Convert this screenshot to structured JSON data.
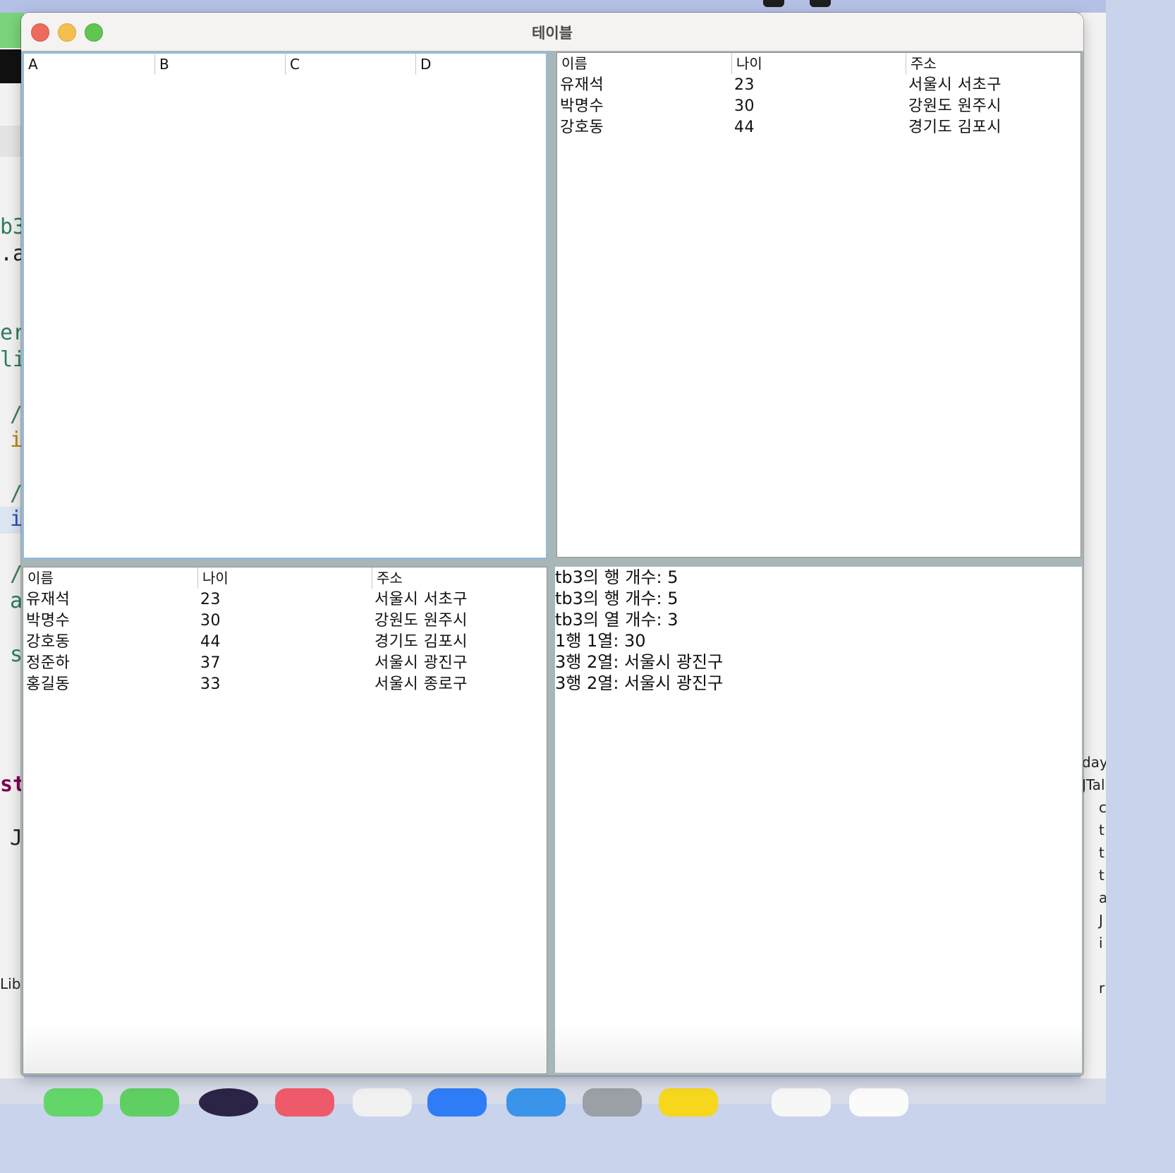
{
  "window": {
    "title": "테이블"
  },
  "table_empty": {
    "columns": [
      "A",
      "B",
      "C",
      "D"
    ]
  },
  "table_small": {
    "columns": [
      "이름",
      "나이",
      "주소"
    ],
    "rows": [
      [
        "유재석",
        "23",
        "서울시 서초구"
      ],
      [
        "박명수",
        "30",
        "강원도 원주시"
      ],
      [
        "강호동",
        "44",
        "경기도 김포시"
      ]
    ]
  },
  "table_full": {
    "columns": [
      "이름",
      "나이",
      "주소"
    ],
    "rows": [
      [
        "유재석",
        "23",
        "서울시 서초구"
      ],
      [
        "박명수",
        "30",
        "강원도 원주시"
      ],
      [
        "강호동",
        "44",
        "경기도 김포시"
      ],
      [
        "정준하",
        "37",
        "서울시 광진구"
      ],
      [
        "홍길동",
        "33",
        "서울시 종로구"
      ]
    ]
  },
  "output_log": [
    "tb3의 행 개수: 5",
    "tb3의 행 개수: 5",
    "tb3의 열 개수: 3",
    "1행 1열: 30",
    "3행 2열: 서울시 광진구",
    "3행 2열: 서울시 광진구"
  ],
  "background": {
    "ide_left_fragments": [
      "b3",
      ".a",
      "er",
      "li",
      "/",
      "i",
      "/",
      "i",
      "/",
      "a",
      "s",
      "st",
      "J",
      "Libr"
    ],
    "ide_right_fragments": [
      "day",
      "JTal",
      "c",
      "t",
      "t",
      "t",
      "a",
      "J",
      "i",
      "r"
    ]
  },
  "colors": {
    "focus_border": "#8fbbe6",
    "close": "#ed6a5e",
    "minimize": "#f5bf4f",
    "maximize": "#61c554"
  }
}
